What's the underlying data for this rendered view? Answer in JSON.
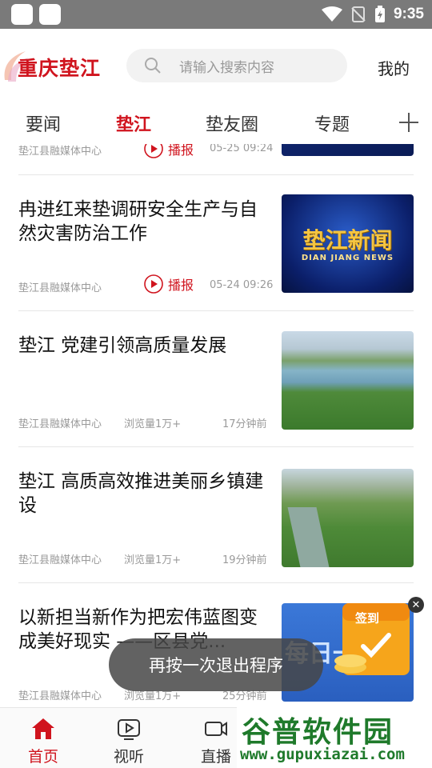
{
  "status_bar": {
    "time": "9:35"
  },
  "header": {
    "logo_text": "重庆垫江",
    "search_placeholder": "请输入搜索内容",
    "mine_label": "我的"
  },
  "tabs": [
    {
      "label": "要闻",
      "active": false
    },
    {
      "label": "垫江",
      "active": true
    },
    {
      "label": "垫友圈",
      "active": false
    },
    {
      "label": "专题",
      "active": false
    }
  ],
  "articles": [
    {
      "title": "",
      "source": "垫江县融媒体中心",
      "play_label": "播报",
      "time": "05-25 09:24"
    },
    {
      "title": "冉进红来垫调研安全生产与自然灾害防治工作",
      "source": "垫江县融媒体中心",
      "play_label": "播报",
      "time": "05-24 09:26",
      "thumb_text": "垫江新闻",
      "thumb_sub": "DIAN JIANG NEWS"
    },
    {
      "title": "垫江 党建引领高质量发展",
      "source": "垫江县融媒体中心",
      "views": "浏览量1万+",
      "time": "17分钟前"
    },
    {
      "title": "垫江 高质高效推进美丽乡镇建设",
      "source": "垫江县融媒体中心",
      "views": "浏览量1万+",
      "time": "19分钟前"
    },
    {
      "title": "以新担当新作为把宏伟蓝图变成美好现实 ——区县党...",
      "source": "垫江县融媒体中心",
      "views": "浏览量1万+",
      "time": "25分钟前",
      "thumb_text": "每日一"
    }
  ],
  "toast": "再按一次退出程序",
  "ad": {
    "label": "签到"
  },
  "bottom_nav": [
    {
      "label": "首页",
      "icon": "home-icon",
      "active": true
    },
    {
      "label": "视听",
      "icon": "tv-icon",
      "active": false
    },
    {
      "label": "直播",
      "icon": "camera-icon",
      "active": false
    }
  ],
  "watermark": {
    "main": "谷普软件园",
    "url": "www.gupuxiazai.com"
  },
  "colors": {
    "accent": "#d0141e",
    "watermark": "#1f7a2b"
  }
}
